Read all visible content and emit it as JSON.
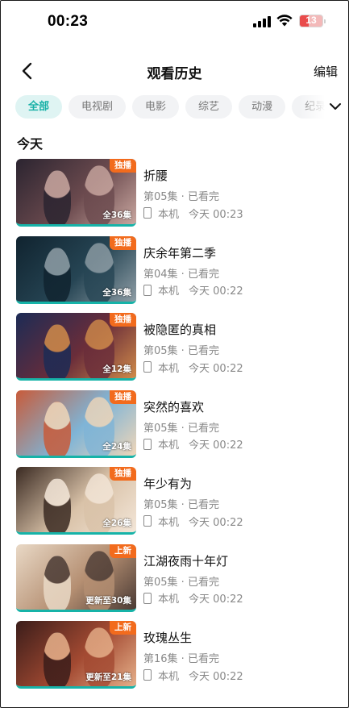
{
  "status_bar": {
    "time": "00:23",
    "battery": "13"
  },
  "header": {
    "title": "观看历史",
    "edit_label": "编辑"
  },
  "tabs": [
    {
      "label": "全部",
      "active": true
    },
    {
      "label": "电视剧",
      "active": false
    },
    {
      "label": "电影",
      "active": false
    },
    {
      "label": "综艺",
      "active": false
    },
    {
      "label": "动漫",
      "active": false
    },
    {
      "label": "纪录片",
      "active": false
    }
  ],
  "section": {
    "title": "今天"
  },
  "items": [
    {
      "title": "折腰",
      "badge": "独播",
      "episodes": "全36集",
      "progress": "第05集 · 已看完",
      "device": "本机",
      "watched": "今天 00:23",
      "colors": [
        "#2b2430",
        "#6b4a4e",
        "#c9a7a0"
      ]
    },
    {
      "title": "庆余年第二季",
      "badge": "独播",
      "episodes": "全36集",
      "progress": "第04集 · 已看完",
      "device": "本机",
      "watched": "今天 00:22",
      "colors": [
        "#10232f",
        "#264554",
        "#8f9ea6"
      ]
    },
    {
      "title": "被隐匿的真相",
      "badge": "独播",
      "episodes": "全12集",
      "progress": "第05集 · 已看完",
      "device": "本机",
      "watched": "今天 00:22",
      "colors": [
        "#1c2b55",
        "#6a2d3a",
        "#d08b4a"
      ]
    },
    {
      "title": "突然的喜欢",
      "badge": "独播",
      "episodes": "全24集",
      "progress": "第05集 · 已看完",
      "device": "本机",
      "watched": "今天 00:22",
      "colors": [
        "#c85b3a",
        "#7fb4d6",
        "#f0d6b8"
      ]
    },
    {
      "title": "年少有为",
      "badge": "独播",
      "episodes": "全26集",
      "progress": "第05集 · 已看完",
      "device": "本机",
      "watched": "今天 00:22",
      "colors": [
        "#3a2a22",
        "#d9c2a8",
        "#f3e6d8"
      ]
    },
    {
      "title": "江湖夜雨十年灯",
      "badge": "上新",
      "episodes": "更新至30集",
      "progress": "第05集 · 已看完",
      "device": "本机",
      "watched": "今天 00:22",
      "colors": [
        "#e9d9c6",
        "#b58f72",
        "#4a3a34"
      ]
    },
    {
      "title": "玫瑰丛生",
      "badge": "上新",
      "episodes": "更新至21集",
      "progress": "第16集 · 已看完",
      "device": "本机",
      "watched": "今天 00:22",
      "colors": [
        "#3b1d1a",
        "#a34a32",
        "#e6b08a"
      ]
    }
  ]
}
